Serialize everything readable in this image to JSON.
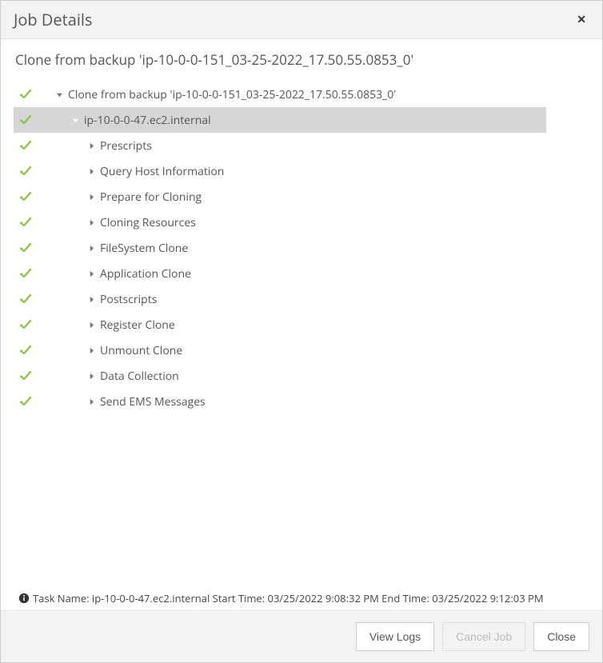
{
  "header": {
    "title": "Job Details"
  },
  "subtitle": "Clone from backup 'ip-10-0-0-151_03-25-2022_17.50.55.0853_0'",
  "tree": [
    {
      "level": 1,
      "status": "success",
      "expanded": true,
      "selected": false,
      "label": "Clone from backup 'ip-10-0-0-151_03-25-2022_17.50.55.0853_0'"
    },
    {
      "level": 2,
      "status": "success",
      "expanded": true,
      "selected": true,
      "label": "ip-10-0-0-47.ec2.internal"
    },
    {
      "level": 3,
      "status": "success",
      "expanded": false,
      "selected": false,
      "label": "Prescripts"
    },
    {
      "level": 3,
      "status": "success",
      "expanded": false,
      "selected": false,
      "label": "Query Host Information"
    },
    {
      "level": 3,
      "status": "success",
      "expanded": false,
      "selected": false,
      "label": "Prepare for Cloning"
    },
    {
      "level": 3,
      "status": "success",
      "expanded": false,
      "selected": false,
      "label": "Cloning Resources"
    },
    {
      "level": 3,
      "status": "success",
      "expanded": false,
      "selected": false,
      "label": "FileSystem Clone"
    },
    {
      "level": 3,
      "status": "success",
      "expanded": false,
      "selected": false,
      "label": "Application Clone"
    },
    {
      "level": 3,
      "status": "success",
      "expanded": false,
      "selected": false,
      "label": "Postscripts"
    },
    {
      "level": 3,
      "status": "success",
      "expanded": false,
      "selected": false,
      "label": "Register Clone"
    },
    {
      "level": 3,
      "status": "success",
      "expanded": false,
      "selected": false,
      "label": "Unmount Clone"
    },
    {
      "level": 3,
      "status": "success",
      "expanded": false,
      "selected": false,
      "label": "Data Collection"
    },
    {
      "level": 3,
      "status": "success",
      "expanded": false,
      "selected": false,
      "label": "Send EMS Messages"
    }
  ],
  "taskInfo": "Task Name: ip-10-0-0-47.ec2.internal Start Time: 03/25/2022 9:08:32 PM End Time: 03/25/2022 9:12:03 PM",
  "footer": {
    "viewLogs": "View Logs",
    "cancelJob": "Cancel Job",
    "close": "Close"
  }
}
